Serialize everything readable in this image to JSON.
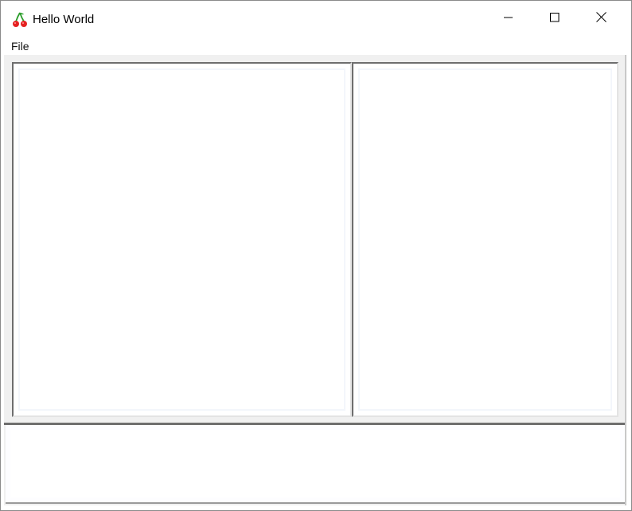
{
  "window": {
    "title": "Hello World",
    "icon": "cherry-icon",
    "controls": {
      "minimize_icon": "minimize-icon",
      "maximize_icon": "maximize-icon",
      "close_icon": "close-icon"
    }
  },
  "menubar": {
    "items": [
      {
        "label": "File"
      }
    ]
  },
  "colors": {
    "cherry_red": "#e52222",
    "stem_green": "#2a9d2a",
    "pane_border_dark": "#6e6e6e",
    "client_bg": "#f0f0f0"
  },
  "panes": {
    "left_text": "",
    "right_text": "",
    "bottom_text": ""
  }
}
